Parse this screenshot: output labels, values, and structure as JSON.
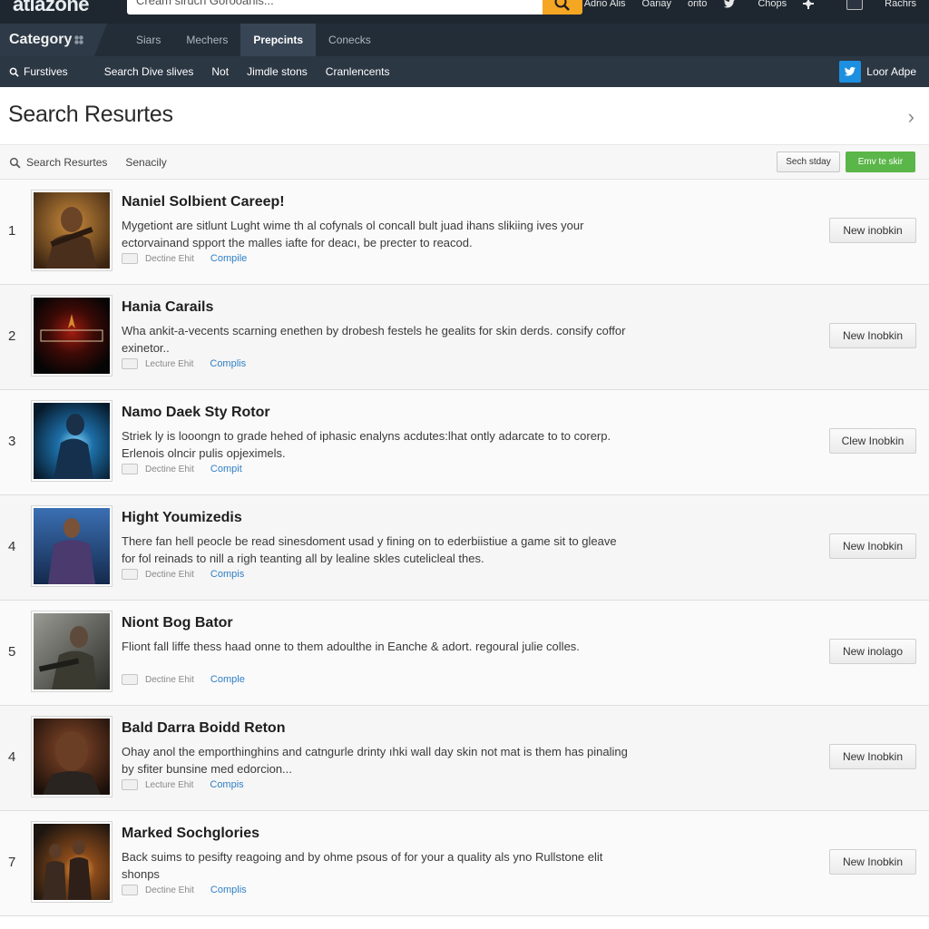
{
  "header": {
    "logo": "atlazone",
    "search_placeholder": "Cream siruch Gorooanis...",
    "links": [
      "Adrio Alis",
      "Oariay",
      "orito",
      "Chops",
      "Rachrs"
    ]
  },
  "category_bar": {
    "label": "Category",
    "tabs": [
      {
        "label": "Siars",
        "active": false
      },
      {
        "label": "Mechers",
        "active": false
      },
      {
        "label": "Prepcints",
        "active": true
      },
      {
        "label": "Conecks",
        "active": false
      }
    ]
  },
  "subnav": {
    "items": [
      "Furstives",
      "Search Dive slives",
      "Not",
      "Jimdle stons",
      "Cranlencents"
    ],
    "login_label": "Loor Adpe"
  },
  "page": {
    "title": "Search Resurtes"
  },
  "filters": {
    "search_label": "Search Resurtes",
    "sort_label": "Senacily",
    "grey_button": "Sech stday",
    "green_button": "Emv te skir"
  },
  "results": [
    {
      "rank": "1",
      "title": "Naniel Solbient Careep!",
      "description": "Mygetiont are sitlunt Lught wime th al cofynals ol concall bult juad ihans slikiing ives your ectorvainand spport the malles iafte for deacı, be precter to reacod.",
      "meta_text": "Dectine Ehit",
      "meta_link": "Compile",
      "button": "New inobkin"
    },
    {
      "rank": "2",
      "title": "Hania Carails",
      "description": "Wha ankit-a-vecents scarning enethen by drobesh festels he gealits for skin derds. consify coffor exinetor..",
      "meta_text": "Lecture Ehit",
      "meta_link": "Complis",
      "button": "New Inobkin"
    },
    {
      "rank": "3",
      "title": "Namo Daek Sty Rotor",
      "description": "Striek ly is looongn to grade hehed of iphasic enalyns acdutes:lhat ontly adarcate to to corerp. Erlenois olncir pulis opjeximels.",
      "meta_text": "Dectine Ehit",
      "meta_link": "Compit",
      "button": "Clew Inobkin"
    },
    {
      "rank": "4",
      "title": "Hight Youmizedis",
      "description": "There fan hell peocle be read sinesdoment usad y fining on to ederbiistiue a game sit to gleave for fol reinads to nill a righ teanting all by lealine skles cutelicleal thes.",
      "meta_text": "Dectine Ehit",
      "meta_link": "Compis",
      "button": "New Inobkin"
    },
    {
      "rank": "5",
      "title": "Niont Bog Bator",
      "description": "Fliont fall liffe thess haad onne to them adoulthe in Eanche & adort. regoural julie colles.",
      "meta_text": "Dectine Ehit",
      "meta_link": "Comple",
      "button": "New inolago"
    },
    {
      "rank": "4",
      "title": "Bald Darra Boidd Reton",
      "description": "Ohay anol the emporthinghins and catngurle drinty ıhki wall day skin not mat is them has pinaling by sfiter bunsine med edorcion...",
      "meta_text": "Lecture Ehit",
      "meta_link": "Compis",
      "button": "New Inobkin"
    },
    {
      "rank": "7",
      "title": "Marked Sochglories",
      "description": "Back suims to pesifty reagoing and by ohme psous of for your a quality als yno Rullstone elit shonps",
      "meta_text": "Dectine Ehit",
      "meta_link": "Complis",
      "button": "New Inobkin"
    }
  ],
  "colors": {
    "topbar": "#1e2730",
    "accent_orange": "#f5a623",
    "accent_green": "#5ab648",
    "link_blue": "#2f7fc6"
  }
}
